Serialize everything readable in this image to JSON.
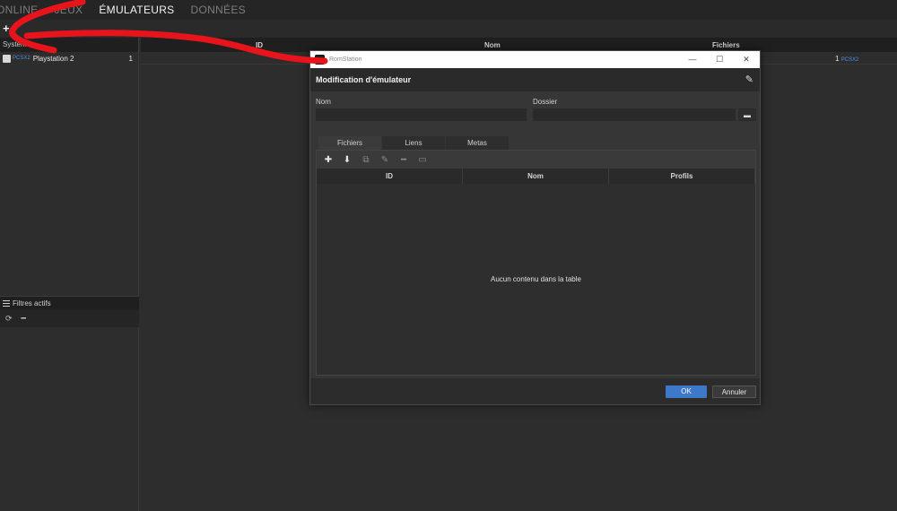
{
  "nav": {
    "items": [
      "ONLINE",
      "JEUX",
      "ÉMULATEURS",
      "DONNÉES"
    ],
    "active": "ÉMULATEURS"
  },
  "toolbar": {
    "add_symbol": "+"
  },
  "left": {
    "header": "Systèmes",
    "systems": [
      {
        "icon": "PCSX2",
        "name": "Playstation 2",
        "count": "1"
      }
    ],
    "filters_title": "Filtres actifs"
  },
  "main": {
    "columns": [
      "ID",
      "Nom",
      "Fichiers"
    ],
    "row": {
      "count": "1",
      "icon": "PCSX2"
    }
  },
  "dialog": {
    "window_title": "RomStation",
    "title": "Modification d'émulateur",
    "name_label": "Nom",
    "folder_label": "Dossier",
    "name_value": "",
    "folder_value": "",
    "tabs": [
      "Fichiers",
      "Liens",
      "Metas"
    ],
    "active_tab": "Fichiers",
    "columns": [
      "ID",
      "Nom",
      "Profils"
    ],
    "empty_message": "Aucun contenu dans la table",
    "ok_label": "OK",
    "cancel_label": "Annuler"
  },
  "colors": {
    "accent": "#3e78c8",
    "annotation": "#e8141c"
  }
}
